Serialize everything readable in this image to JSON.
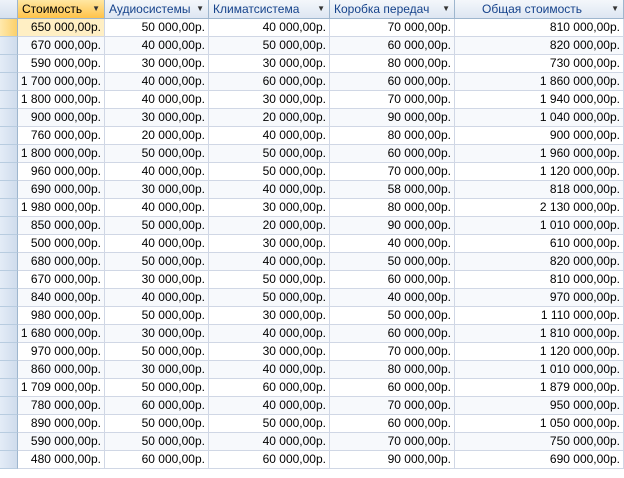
{
  "columns": [
    "Стоимость",
    "Аудиосистемы",
    "Климатсистема",
    "Коробка передач",
    "Общая стоимость"
  ],
  "rows": [
    [
      "650 000,00р.",
      "50 000,00р.",
      "40 000,00р.",
      "70 000,00р.",
      "810 000,00р."
    ],
    [
      "670 000,00р.",
      "40 000,00р.",
      "50 000,00р.",
      "60 000,00р.",
      "820 000,00р."
    ],
    [
      "590 000,00р.",
      "30 000,00р.",
      "30 000,00р.",
      "80 000,00р.",
      "730 000,00р."
    ],
    [
      "1 700 000,00р.",
      "40 000,00р.",
      "60 000,00р.",
      "60 000,00р.",
      "1 860 000,00р."
    ],
    [
      "1 800 000,00р.",
      "40 000,00р.",
      "30 000,00р.",
      "70 000,00р.",
      "1 940 000,00р."
    ],
    [
      "900 000,00р.",
      "30 000,00р.",
      "20 000,00р.",
      "90 000,00р.",
      "1 040 000,00р."
    ],
    [
      "760 000,00р.",
      "20 000,00р.",
      "40 000,00р.",
      "80 000,00р.",
      "900 000,00р."
    ],
    [
      "1 800 000,00р.",
      "50 000,00р.",
      "50 000,00р.",
      "60 000,00р.",
      "1 960 000,00р."
    ],
    [
      "960 000,00р.",
      "40 000,00р.",
      "50 000,00р.",
      "70 000,00р.",
      "1 120 000,00р."
    ],
    [
      "690 000,00р.",
      "30 000,00р.",
      "40 000,00р.",
      "58 000,00р.",
      "818 000,00р."
    ],
    [
      "1 980 000,00р.",
      "40 000,00р.",
      "30 000,00р.",
      "80 000,00р.",
      "2 130 000,00р."
    ],
    [
      "850 000,00р.",
      "50 000,00р.",
      "20 000,00р.",
      "90 000,00р.",
      "1 010 000,00р."
    ],
    [
      "500 000,00р.",
      "40 000,00р.",
      "30 000,00р.",
      "40 000,00р.",
      "610 000,00р."
    ],
    [
      "680 000,00р.",
      "50 000,00р.",
      "40 000,00р.",
      "50 000,00р.",
      "820 000,00р."
    ],
    [
      "670 000,00р.",
      "30 000,00р.",
      "50 000,00р.",
      "60 000,00р.",
      "810 000,00р."
    ],
    [
      "840 000,00р.",
      "40 000,00р.",
      "50 000,00р.",
      "40 000,00р.",
      "970 000,00р."
    ],
    [
      "980 000,00р.",
      "50 000,00р.",
      "30 000,00р.",
      "50 000,00р.",
      "1 110 000,00р."
    ],
    [
      "1 680 000,00р.",
      "30 000,00р.",
      "40 000,00р.",
      "60 000,00р.",
      "1 810 000,00р."
    ],
    [
      "970 000,00р.",
      "50 000,00р.",
      "30 000,00р.",
      "70 000,00р.",
      "1 120 000,00р."
    ],
    [
      "860 000,00р.",
      "30 000,00р.",
      "40 000,00р.",
      "80 000,00р.",
      "1 010 000,00р."
    ],
    [
      "1 709 000,00р.",
      "50 000,00р.",
      "60 000,00р.",
      "60 000,00р.",
      "1 879 000,00р."
    ],
    [
      "780 000,00р.",
      "60 000,00р.",
      "40 000,00р.",
      "70 000,00р.",
      "950 000,00р."
    ],
    [
      "890 000,00р.",
      "50 000,00р.",
      "50 000,00р.",
      "60 000,00р.",
      "1 050 000,00р."
    ],
    [
      "590 000,00р.",
      "50 000,00р.",
      "40 000,00р.",
      "70 000,00р.",
      "750 000,00р."
    ],
    [
      "480 000,00р.",
      "60 000,00р.",
      "60 000,00р.",
      "90 000,00р.",
      "690 000,00р."
    ]
  ],
  "icons": {
    "sort_arrow": "dropdown-arrow-icon"
  },
  "colors": {
    "active_header": "#ffc34a",
    "header_text": "#15428b",
    "grid_line": "#d0d7e5"
  }
}
